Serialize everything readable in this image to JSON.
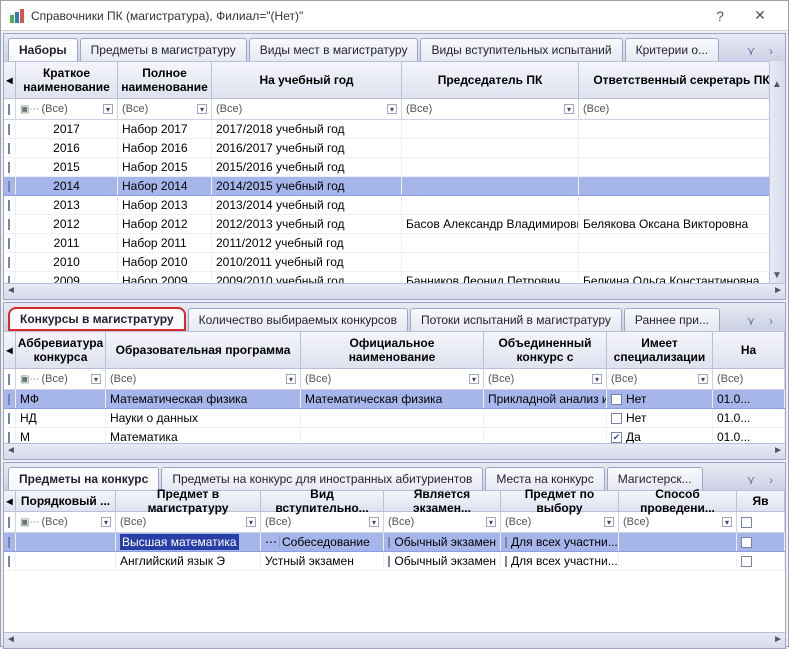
{
  "window": {
    "title": "Справочники ПК (магистратура), Филиал=\"(Нет)\"",
    "help_hint": "?",
    "close_hint": "✕"
  },
  "panel1": {
    "tabs": [
      "Наборы",
      "Предметы в магистратуру",
      "Виды мест в магистратуру",
      "Виды вступительных испытаний",
      "Критерии о..."
    ],
    "active_tab": 0,
    "columns": [
      "Краткое наименование",
      "Полное наименование",
      "На учебный год",
      "Председатель ПК",
      "Ответственный секретарь ПК"
    ],
    "filter_text": "(Все)",
    "rows": [
      {
        "short": "2017",
        "full": "Набор 2017",
        "year": "2017/2018 учебный год",
        "chair": "",
        "sec": ""
      },
      {
        "short": "2016",
        "full": "Набор 2016",
        "year": "2016/2017 учебный год",
        "chair": "",
        "sec": ""
      },
      {
        "short": "2015",
        "full": "Набор 2015",
        "year": "2015/2016 учебный год",
        "chair": "",
        "sec": ""
      },
      {
        "short": "2014",
        "full": "Набор 2014",
        "year": "2014/2015 учебный год",
        "chair": "",
        "sec": "",
        "selected": true
      },
      {
        "short": "2013",
        "full": "Набор 2013",
        "year": "2013/2014 учебный год",
        "chair": "",
        "sec": ""
      },
      {
        "short": "2012",
        "full": "Набор 2012",
        "year": "2012/2013 учебный год",
        "chair": "Басов Александр Владимирович",
        "sec": "Белякова Оксана Викторовна"
      },
      {
        "short": "2011",
        "full": "Набор 2011",
        "year": "2011/2012 учебный год",
        "chair": "",
        "sec": ""
      },
      {
        "short": "2010",
        "full": "Набор 2010",
        "year": "2010/2011 учебный год",
        "chair": "",
        "sec": ""
      },
      {
        "short": "2009",
        "full": "Набор 2009",
        "year": "2009/2010 учебный год",
        "chair": "Банников Леонид Петрович",
        "sec": "Белкина Ольга Константиновна"
      }
    ]
  },
  "panel2": {
    "tabs": [
      "Конкурсы в магистратуру",
      "Количество выбираемых конкурсов",
      "Потоки испытаний в магистратуру",
      "Раннее при..."
    ],
    "active_tab": 0,
    "columns": [
      "Аббревиатура конкурса",
      "Образовательная программа",
      "Официальное наименование",
      "Объединенный конкурс с",
      "Имеет специализации",
      "На"
    ],
    "filter_text": "(Все)",
    "rows": [
      {
        "abbr": "МФ",
        "prog": "Математическая физика",
        "off": "Математическая физика",
        "union": "Прикладной анализ и",
        "spec": "Нет",
        "spec_checked": false,
        "na": "01.0...",
        "selected": true
      },
      {
        "abbr": "НД",
        "prog": "Науки о данных",
        "off": "",
        "union": "",
        "spec": "Нет",
        "spec_checked": false,
        "na": "01.0..."
      },
      {
        "abbr": "М",
        "prog": "Математика",
        "off": "",
        "union": "",
        "spec": "Да",
        "spec_checked": true,
        "na": "01.0..."
      }
    ]
  },
  "panel3": {
    "tabs": [
      "Предметы на конкурс",
      "Предметы на конкурс для иностранных абитуриентов",
      "Места на конкурс",
      "Магистерск..."
    ],
    "active_tab": 0,
    "columns": [
      "Порядковый ...",
      "Предмет в магистратуру",
      "Вид вступительно...",
      "Является экзамен...",
      "Предмет по выбору",
      "Способ проведени...",
      "Яв"
    ],
    "filter_text": "(Все)",
    "rows": [
      {
        "ord": "",
        "subj": "Высшая математика",
        "kind": "Собеседование",
        "exam": "Обычный экзамен",
        "exam_checked": false,
        "choice": "Для всех участни...",
        "choice_checked": false,
        "method": "",
        "selected": true,
        "subj_hl": true,
        "kind_edit": true
      },
      {
        "ord": "",
        "subj": "Английский язык Э",
        "kind": "Устный экзамен",
        "exam": "Обычный экзамен",
        "exam_checked": false,
        "choice": "Для всех участни...",
        "choice_checked": false,
        "method": ""
      }
    ]
  }
}
